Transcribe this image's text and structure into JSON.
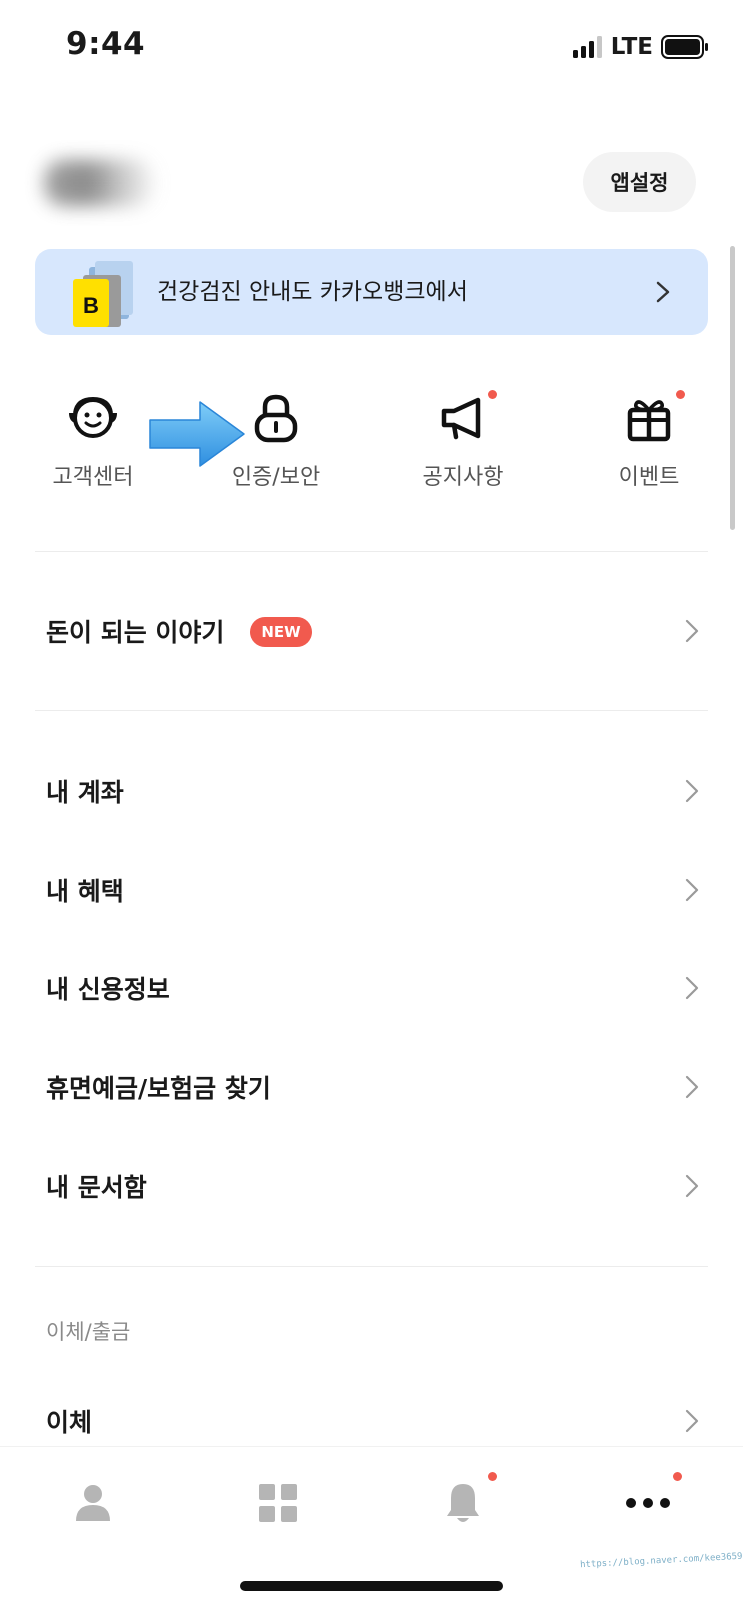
{
  "status_bar": {
    "time": "9:44",
    "network": "LTE"
  },
  "header": {
    "settings_label": "앱설정"
  },
  "banner": {
    "text": "건강검진 안내도 카카오뱅크에서",
    "logo_letter": "B"
  },
  "quick_menu": [
    {
      "label": "고객센터",
      "icon": "headset-face-icon",
      "has_dot": false
    },
    {
      "label": "인증/보안",
      "icon": "lock-icon",
      "has_dot": false
    },
    {
      "label": "공지사항",
      "icon": "megaphone-icon",
      "has_dot": true
    },
    {
      "label": "이벤트",
      "icon": "gift-icon",
      "has_dot": true
    }
  ],
  "featured": {
    "label": "돈이 되는 이야기",
    "badge": "NEW"
  },
  "menu_items": [
    "내 계좌",
    "내 혜택",
    "내 신용정보",
    "휴면예금/보험금 찾기",
    "내 문서함"
  ],
  "transfer_section": {
    "title": "이체/출금",
    "items": [
      "이체"
    ]
  },
  "tab_bar": [
    {
      "icon": "person-icon",
      "has_dot": false
    },
    {
      "icon": "grid-icon",
      "has_dot": false
    },
    {
      "icon": "bell-icon",
      "has_dot": true
    },
    {
      "icon": "more-icon",
      "has_dot": true,
      "active": true
    }
  ],
  "watermark": "https://blog.naver.com/kee3659",
  "colors": {
    "accent_dot": "#f15a4e",
    "banner_bg": "#d7e7fd",
    "arrow": "#3aa6f0"
  }
}
